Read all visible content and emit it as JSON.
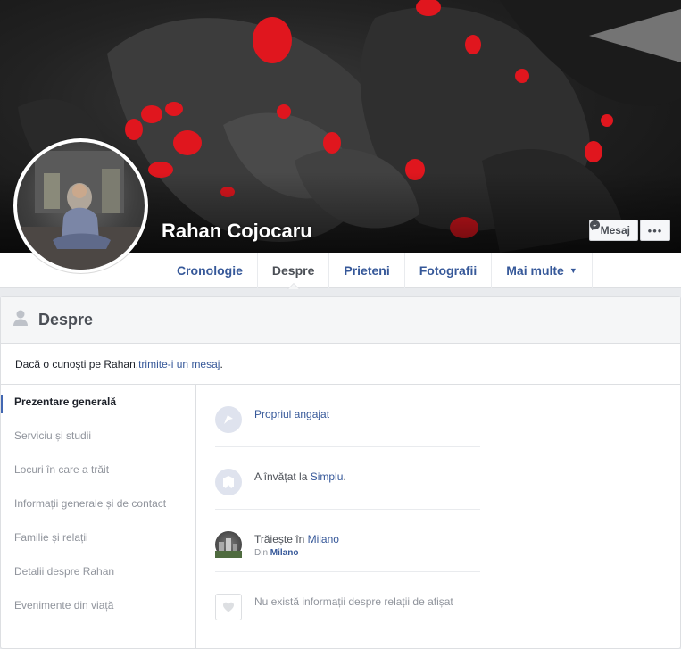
{
  "profile": {
    "name": "Rahan Cojocaru",
    "message_button": "Mesaj",
    "more_button": "•••"
  },
  "tabs": [
    {
      "label": "Cronologie"
    },
    {
      "label": "Despre"
    },
    {
      "label": "Prieteni"
    },
    {
      "label": "Fotografii"
    },
    {
      "label": "Mai multe"
    }
  ],
  "about": {
    "title": "Despre",
    "hint_prefix": "Dacă o cunoști pe Rahan, ",
    "hint_link": "trimite-i un mesaj",
    "hint_suffix": ".",
    "nav": [
      {
        "label": "Prezentare generală"
      },
      {
        "label": "Serviciu și studii"
      },
      {
        "label": "Locuri în care a trăit"
      },
      {
        "label": "Informații generale și de contact"
      },
      {
        "label": "Familie și relații"
      },
      {
        "label": "Detalii despre Rahan"
      },
      {
        "label": "Evenimente din viață"
      }
    ],
    "overview": {
      "work": "Propriul angajat",
      "edu_prefix": "A învățat la ",
      "edu_link": "Simplu",
      "edu_suffix": ".",
      "lives_prefix": "Trăiește în ",
      "lives_link": "Milano",
      "from_prefix": "Din ",
      "from_link": "Milano",
      "relationship": "Nu există informații despre relații de afișat"
    }
  },
  "icons": {
    "message": "messenger-icon",
    "work": "briefcase-flag-icon",
    "education": "graduation-icon",
    "location": "city-photo-icon",
    "relationship": "heart-icon",
    "about": "person-icon",
    "dropdown": "caret-down-icon"
  },
  "colors": {
    "link": "#365899",
    "accent": "#4267b2",
    "cover_spots": "#e0161e"
  }
}
